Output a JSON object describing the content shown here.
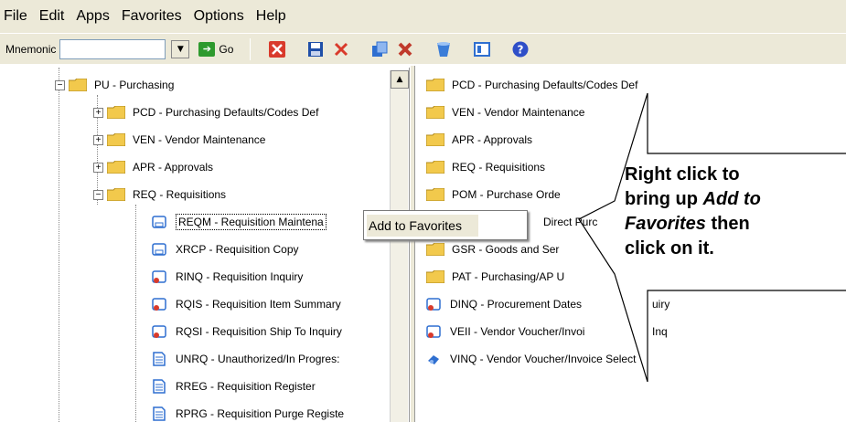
{
  "menu": [
    "File",
    "Edit",
    "Apps",
    "Favorites",
    "Options",
    "Help"
  ],
  "toolbar": {
    "mnemonic_label": "Mnemonic",
    "mnemonic_value": "",
    "go_label": "Go",
    "icons": [
      "close-x-icon",
      "save-icon",
      "delete-icon",
      "copy-icon",
      "remove-icon",
      "clear-icon",
      "view-icon",
      "help-icon"
    ]
  },
  "left_tree": {
    "root": "PU - Purchasing",
    "children": [
      "PCD - Purchasing Defaults/Codes Def",
      "VEN - Vendor Maintenance",
      "APR - Approvals",
      "REQ - Requisitions"
    ],
    "req_children": [
      "REQM - Requisition Maintena",
      "XRCP - Requisition Copy",
      "RINQ - Requisition Inquiry",
      "RQIS - Requisition Item Summary",
      "RQSI - Requisition Ship To Inquiry",
      "UNRQ - Unauthorized/In Progres:",
      "RREG - Requisition Register",
      "RPRG - Requisition Purge Registe"
    ]
  },
  "right_list": [
    "PCD - Purchasing Defaults/Codes Def",
    "VEN - Vendor Maintenance",
    "APR - Approvals",
    "REQ - Requisitions",
    "POM - Purchase Orde",
    "Direct Purc",
    "GSR - Goods and Ser",
    "PAT - Purchasing/AP U",
    "DINQ - Procurement Dates",
    "uiry",
    "VEII - Vendor Voucher/Invoi",
    "Inq",
    "VINQ - Vendor Voucher/Invoice Select"
  ],
  "context_menu": {
    "item": "Add to Favorites"
  },
  "callout": {
    "line1": "Right click to",
    "line2_pre": "bring up ",
    "line2_em": "Add to",
    "line3_em": "Favorites",
    "line3_post": " then",
    "line4": "click on it."
  },
  "colors": {
    "chrome": "#ece9d8",
    "folder": "#f2c94c",
    "go_green": "#2e9a2e",
    "close_red": "#d93a2b",
    "save_blue": "#1f4fa8"
  }
}
